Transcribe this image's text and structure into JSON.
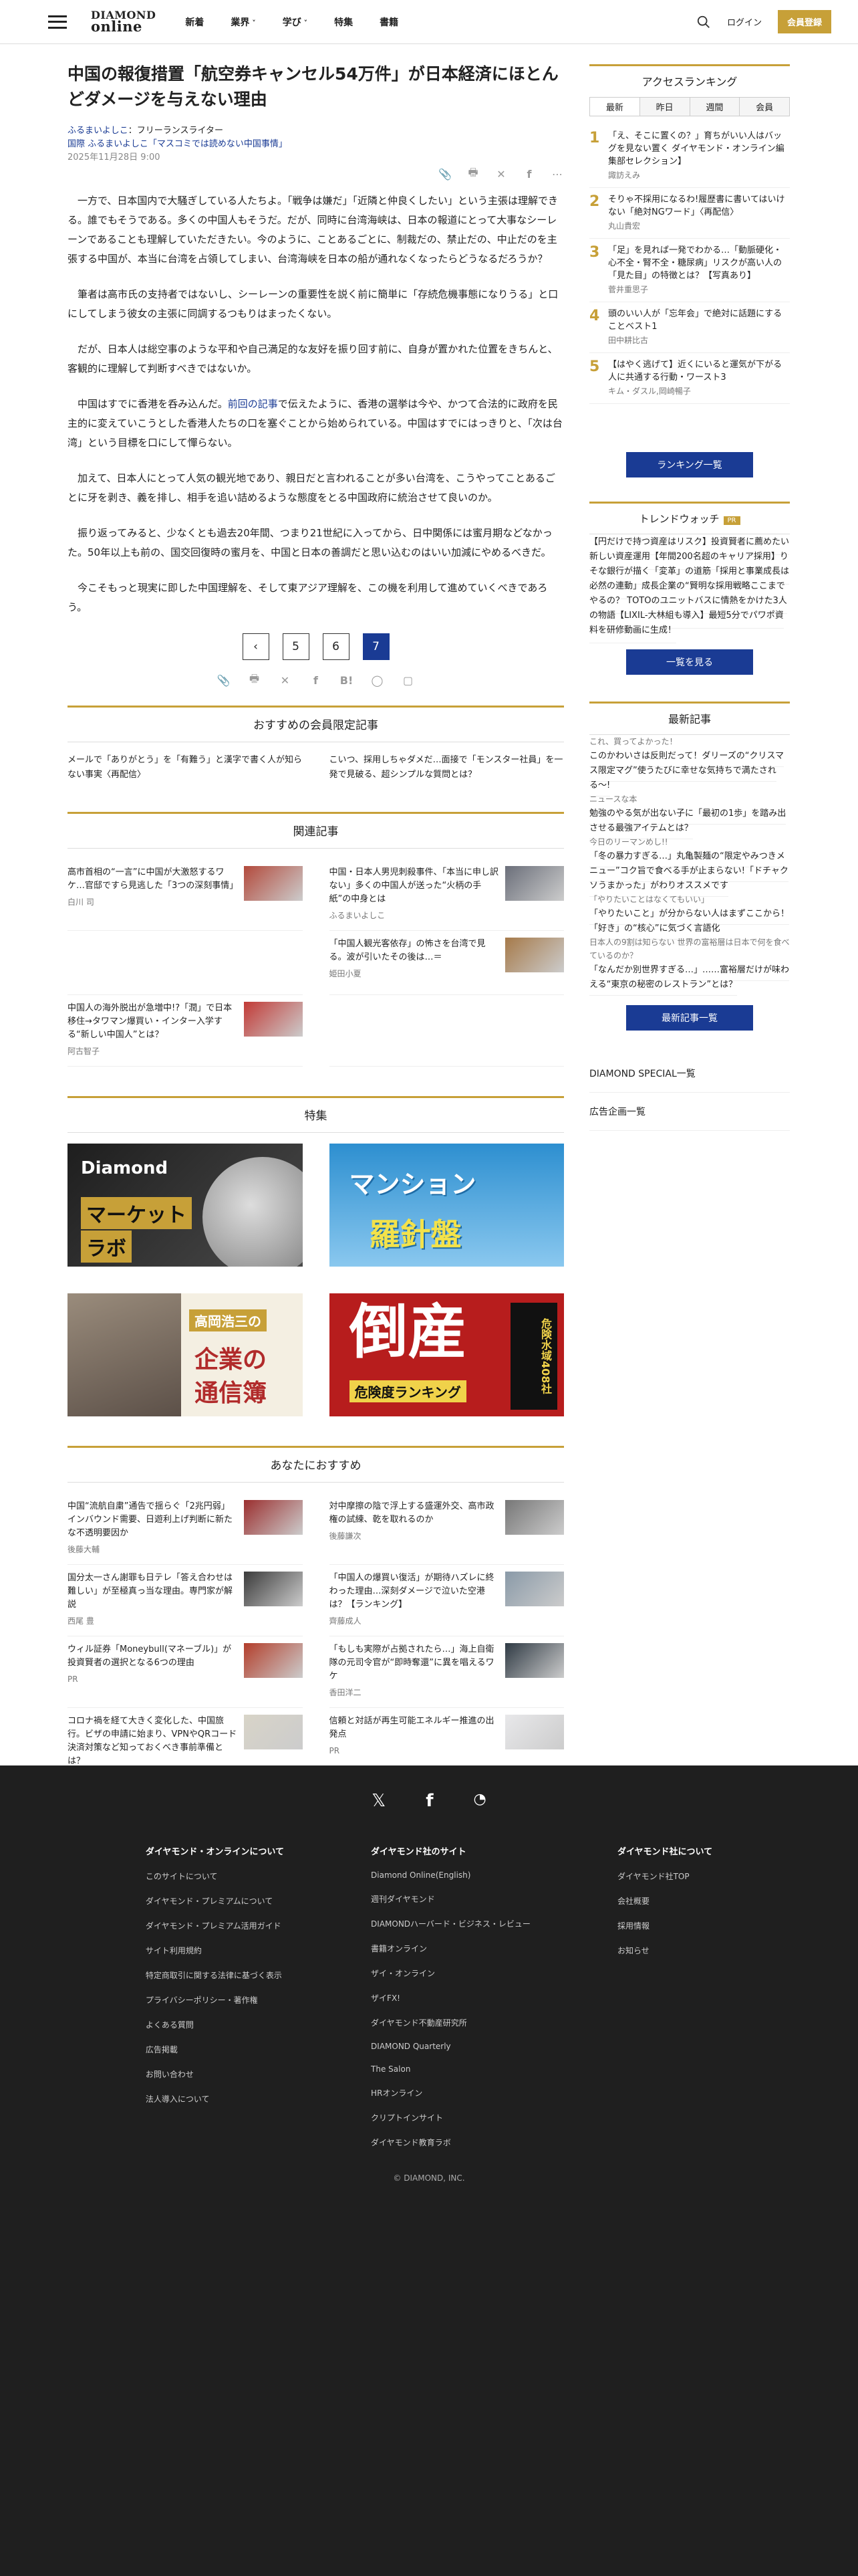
{
  "header": {
    "logo_top": "DIAMOND",
    "logo_bottom": "online",
    "nav": [
      "新着",
      "業界",
      "学び",
      "特集",
      "書籍"
    ],
    "login": "ログイン",
    "register": "会員登録"
  },
  "article": {
    "title": "中国の報復措置「航空券キャンセル54万件」が日本経済にほとんどダメージを与えない理由",
    "author": "ふるまいよしこ",
    "author_role": "フリーランスライター",
    "category": "国際",
    "series": "ふるまいよしこ「マスコミでは読めない中国事情」",
    "date": "2025年11月28日 9:00",
    "paragraphs": [
      {
        "a": "一方で、日本国内で大騒ぎしている人たちよ。「戦争は嫌だ」「近隣と仲良くしたい」という主張は理解できる。誰でもそうである。多くの中国人もそうだ。だが、同時に台湾海峡は、日本の報道にとって大事なシーレーンであることも理解していただきたい。今のように、ことあるごとに、制裁だの、禁止だの、中止だのを主張する中国が、本当に台湾を占領してしまい、台湾海峡を日本の船が通れなくなったらどうなるだろうか？"
      },
      {
        "a": "筆者は高市氏の支持者ではないし、シーレーンの重要性を説く前に簡単に「存続危機事態になりうる」と口にしてしまう彼女の主張に同調するつもりはまったくない。"
      },
      {
        "a": "だが、日本人は総空事のような平和や自己満足的な友好を振り回す前に、自身が置かれた位置をきちんと、客観的に理解して判断すべきではないか。"
      },
      {
        "a": "中国はすでに香港を呑み込んだ。",
        "link": "前回の記事",
        "b": "で伝えたように、香港の選挙は今や、かつて合法的に政府を民主的に変えていこうとした香港人たちの口を塞ぐことから始められている。中国はすでにはっきりと、「次は台湾」という目標を口にして憚らない。"
      },
      {
        "a": "加えて、日本人にとって人気の観光地であり、親日だと言われることが多い台湾を、こうやってことあるごとに牙を剥き、義を排し、相手を追い詰めるような態度をとる中国政府に統治させて良いのか。"
      },
      {
        "a": "振り返ってみると、少なくとも過去20年間、つまり21世紀に入ってから、日中関係には蜜月期などなかった。50年以上も前の、国交回復時の蜜月を、中国と日本の善調だと思い込むのはいい加減にやめるべきだ。"
      },
      {
        "a": "今こそもっと現実に即した中国理解を、そして東アジア理解を、この機を利用して進めていくべきであろう。"
      }
    ],
    "pages": [
      "5",
      "6",
      "7"
    ],
    "current_page": "7"
  },
  "recommend_member": {
    "title": "おすすめの会員限定記事",
    "items": [
      "メールで「ありがとう」を「有難う」と漢字で書く人が知らない事実〈再配信〉",
      "こいつ、採用しちゃダメだ…面接で「モンスター社員」を一発で見破る、超シンプルな質問とは？"
    ]
  },
  "related": {
    "title": "関連記事",
    "items": [
      {
        "title": "高市首相の“一言”に中国が大激怒するワケ…官邸ですら見逃した「3つの深刻事情」",
        "by": "白川 司",
        "color": "#b34a3c"
      },
      {
        "title": "中国・日本人男児刺殺事件、「本当に申し訳ない」多くの中国人が送った“火柄の手紙”の中身とは",
        "by": "ふるまいよしこ",
        "color": "#6b6f7a"
      },
      {
        "title": "",
        "by": "",
        "color": ""
      },
      {
        "title": "「中国人観光客依存」の怖さを台湾で見る。波が引いたその後は…＝",
        "by": "姫田小夏",
        "color": "#a67a4a"
      },
      {
        "title": "中国人の海外脱出が急増中!?「潤」で日本移住→タワマン爆買い・インター入学する“新しい中国人”とは？",
        "by": "阿古智子",
        "color": "#c23a36"
      },
      {
        "title": "",
        "by": "",
        "color": ""
      }
    ]
  },
  "features": {
    "title": "特集",
    "items": [
      {
        "line1": "Diamond",
        "line2": "マーケット",
        "line3": "ラボ"
      },
      {
        "line1": "マンション",
        "line2": "羅針盤",
        "line3": ""
      },
      {
        "line1": "高岡浩三の",
        "line2": "企業の",
        "line3": "通信簿"
      },
      {
        "line1": "倒産",
        "line2": "危険度ランキング",
        "line3": "危険水域408社"
      }
    ]
  },
  "for_you": {
    "title": "あなたにおすすめ",
    "items": [
      {
        "title": "中国“流航自粛”通告で揺らぐ「2兆円弱」インバウンド需要、日遊利上げ判断に新たな不透明要因か",
        "by": "後藤大輔",
        "color": "#9b2f2f"
      },
      {
        "title": "対中摩擦の陰で浮上する盛運外交、高市政権の試練、乾を取れるのか",
        "by": "後藤謙次",
        "color": "#777"
      },
      {
        "title": "国分太一さん謝罪も日テレ「答え合わせは難しい」が至極真っ当な理由。専門家が解説",
        "by": "西尾 豊",
        "color": "#3b3b3b"
      },
      {
        "title": "「中国人の爆買い復活」が期待ハズレに終わった理由…深刻ダメージで泣いた空港は？【ランキング】",
        "by": "齊藤成人",
        "color": "#8a9aa8"
      },
      {
        "title": "ウィル証券「Moneybull(マネーブル)」が投資賢者の選択となる6つの理由",
        "by": "PR",
        "color": "#b33e2b"
      },
      {
        "title": "「もしも実際が占拠されたら…」海上自衛隊の元司令官が“即時奪還”に異を唱えるワケ",
        "by": "香田洋二",
        "color": "#2f3a44"
      },
      {
        "title": "コロナ禍を経て大きく変化した、中国旅行。ビザの申請に始まり、VPNやQRコード決済対策など知っておくべき事前準備とは？",
        "by": "楠特",
        "color": "#d8d4c8"
      },
      {
        "title": "信頼と対話が再生可能エネルギー推進の出発点",
        "by": "PR",
        "color": "#e8e8ea"
      }
    ]
  },
  "ranking": {
    "title": "アクセスランキング",
    "tabs": [
      "最新",
      "昨日",
      "週間",
      "会員"
    ],
    "items": [
      {
        "n": "1",
        "title": "「え、そこに置くの？」育ちがいい人はバッグを見ない置く ダイヤモンド・オンライン編集部セレクション】",
        "by": "諏訪えみ"
      },
      {
        "n": "2",
        "title": "そりゃ不採用になるわ!履歴書に書いてはいけない「絶対NGワード」〈再配信〉",
        "by": "丸山貴宏"
      },
      {
        "n": "3",
        "title": "「足」を見れば一発でわかる…「動脈硬化・心不全・腎不全・糖尿病」リスクが高い人の「見た目」の特徴とは？【写真あり】",
        "by": "菅井重思子"
      },
      {
        "n": "4",
        "title": "頭のいい人が「忘年会」で絶対に話題にすることベスト1",
        "by": "田中耕比古"
      },
      {
        "n": "5",
        "title": "【はやく逃げて】近くにいると運気が下がる人に共通する行動・ワースト3",
        "by": "キム・ダスル,岡崎暢子"
      }
    ],
    "button": "ランキング一覧"
  },
  "trend": {
    "title": "トレンドウォッチ",
    "badge": "PR",
    "items": [
      "【円だけで持つ資産はリスク】投資賢者に薦めたい新しい資産運用",
      "【年間200名超のキャリア採用】りそな銀行が描く「変革」の道筋",
      "「採用と事業成長は必然の連動」成長企業の“賢明な採用戦略",
      "ここまでやるの？ TOTOのユニットバスに情熱をかけた3人の物語",
      "【LIXIL-大林組も導入】最短5分でパワポ資料を研修動画に生成！"
    ],
    "button": "一覧を見る"
  },
  "latest": {
    "title": "最新記事",
    "items": [
      {
        "cat": "これ、買ってよかった！",
        "title": "このかわいさは反則だって！ダリーズの“クリスマス限定マグ”使うたびに幸せな気持ちで満たされる〜!"
      },
      {
        "cat": "ニュースな本",
        "title": "勉強のやる気が出ない子に「最初の1歩」を踏み出させる最強アイテムとは？"
      },
      {
        "cat": "今日のリーマンめし!!",
        "title": "「冬の暴力すぎる…」丸亀製麺の“限定やみつきメニュー”コク旨で食べる手が止まらない!「ドチャクソうまかった」がわりオススメです"
      },
      {
        "cat": "「やりたいことはなくてもいい」",
        "title": "「やりたいこと」が分からない人はまずここから！「好き」の“核心”に気づく言語化"
      },
      {
        "cat": "日本人の9割は知らない 世界の富裕層は日本で何を食べているのか？",
        "title": "「なんだか別世界すぎる…」……富裕層だけが味わえる“東京の秘密のレストラン”とは？"
      }
    ],
    "button": "最新記事一覧"
  },
  "side_links": [
    "DIAMOND SPECIAL一覧",
    "広告企画一覧"
  ],
  "footer": {
    "cols": [
      {
        "title": "ダイヤモンド・オンラインについて",
        "links": [
          "このサイトについて",
          "ダイヤモンド・プレミアムについて",
          "ダイヤモンド・プレミアム活用ガイド",
          "サイト利用規約",
          "特定商取引に関する法律に基づく表示",
          "プライバシーポリシー・著作権",
          "よくある質問",
          "広告掲載",
          "お問い合わせ",
          "法人導入について"
        ]
      },
      {
        "title": "ダイヤモンド社のサイト",
        "links": [
          "Diamond Online(English)",
          "週刊ダイヤモンド",
          "DIAMONDハーバード・ビジネス・レビュー",
          "書籍オンライン",
          "ザイ・オンライン",
          "ザイFX!",
          "ダイヤモンド不動産研究所",
          "DIAMOND Quarterly",
          "The Salon",
          "HRオンライン",
          "クリプトインサイト",
          "ダイヤモンド教育ラボ"
        ]
      },
      {
        "title": "ダイヤモンド社について",
        "links": [
          "ダイヤモンド社TOP",
          "会社概要",
          "採用情報",
          "お知らせ"
        ]
      }
    ],
    "copyright": "© DIAMOND, INC."
  }
}
